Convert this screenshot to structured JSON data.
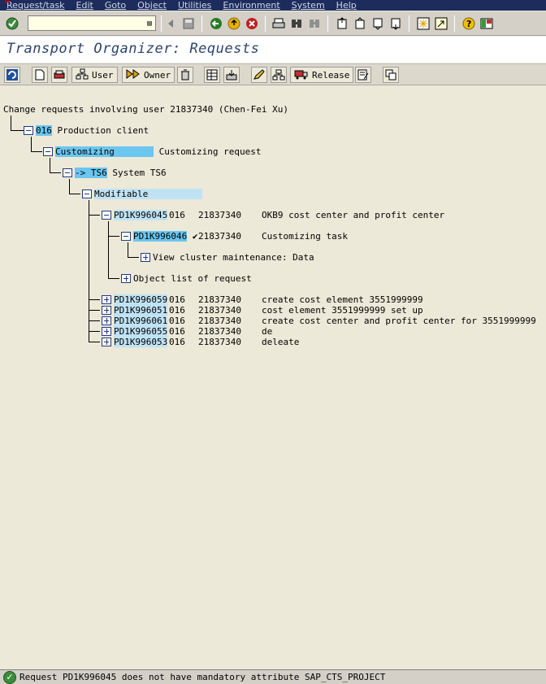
{
  "menu": [
    "Request/task",
    "Edit",
    "Goto",
    "Object",
    "Utilities",
    "Environment",
    "System",
    "Help"
  ],
  "command_field": {
    "value": ""
  },
  "title": "Transport Organizer: Requests",
  "app_toolbar": {
    "user_label": "User",
    "owner_label": "Owner",
    "release_label": "Release"
  },
  "tree": {
    "header": "Change requests involving user 21837340 (Chen-Fei Xu)",
    "client": {
      "id": "016",
      "label": "Production client"
    },
    "category": {
      "name": "Customizing",
      "label": "Customizing request"
    },
    "system": {
      "id": "-> TS6",
      "label": "System TS6"
    },
    "state": "Modifiable",
    "open_request": {
      "id": "PD1K996045",
      "client": "016",
      "user": "21837340",
      "text": "OKB9 cost center and profit center",
      "task": {
        "id": "PD1K996046",
        "check": "✔",
        "user": "21837340",
        "text": "Customizing task",
        "child": "View cluster maintenance: Data"
      },
      "object_list": "Object list of request"
    },
    "requests": [
      {
        "id": "PD1K996059",
        "client": "016",
        "user": "21837340",
        "text": "create cost element 3551999999"
      },
      {
        "id": "PD1K996051",
        "client": "016",
        "user": "21837340",
        "text": "cost element 3551999999 set up"
      },
      {
        "id": "PD1K996061",
        "client": "016",
        "user": "21837340",
        "text": "create cost center and profit center for 3551999999"
      },
      {
        "id": "PD1K996055",
        "client": "016",
        "user": "21837340",
        "text": "de"
      },
      {
        "id": "PD1K996053",
        "client": "016",
        "user": "21837340",
        "text": "deleate"
      }
    ]
  },
  "status": {
    "text": "Request PD1K996045 does not have mandatory attribute SAP_CTS_PROJECT"
  },
  "colors": {
    "menubar": "#1d2c5c",
    "highlight": "#6bc6f0",
    "title": "#2c4470"
  }
}
